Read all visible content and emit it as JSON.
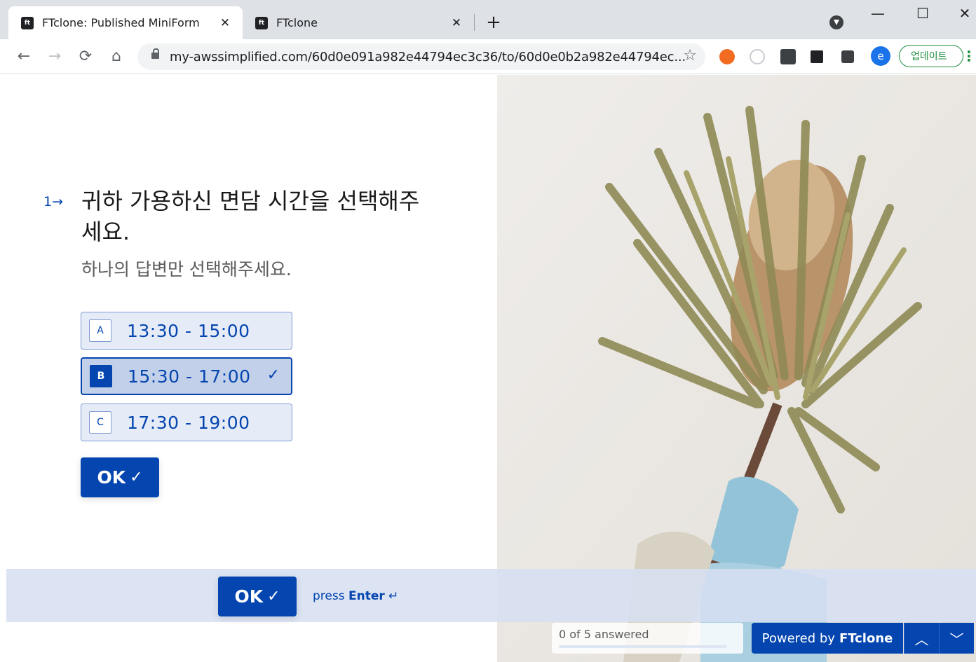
{
  "browser": {
    "tabs": [
      {
        "title": "FTclone: Published MiniForm",
        "favicon": "ft"
      },
      {
        "title": "FTclone",
        "favicon": "ft"
      }
    ],
    "url": "my-awssimplified.com/60d0e091a982e44794ec3c36/to/60d0e0b2a982e44794ec...",
    "profile_initial": "e",
    "update_label": "업데이트",
    "window_controls": [
      "minimize-icon",
      "maximize-icon",
      "close-icon"
    ]
  },
  "form": {
    "question_number": "1→",
    "question_title": "귀하 가용하신 면담 시간을 선택해주세요.",
    "question_hint": "하나의 답변만 선택해주세요.",
    "choices": [
      {
        "key": "A",
        "label": "13:30 - 15:00",
        "selected": false
      },
      {
        "key": "B",
        "label": "15:30 - 17:00",
        "selected": true
      },
      {
        "key": "C",
        "label": "17:30 - 19:00",
        "selected": false
      }
    ],
    "ok_label": "OK",
    "footer_ok_label": "OK",
    "press_prefix": "press",
    "press_key": "Enter",
    "enter_icon": "↵"
  },
  "progress": {
    "text": "0 of 5 answered",
    "fraction": 0
  },
  "branding": {
    "powered_by": "Powered by",
    "brand": "FTclone"
  },
  "colors": {
    "accent": "#0445af",
    "choice_bg": "#e6ecf7",
    "choice_selected_bg": "#c2d0ea"
  }
}
